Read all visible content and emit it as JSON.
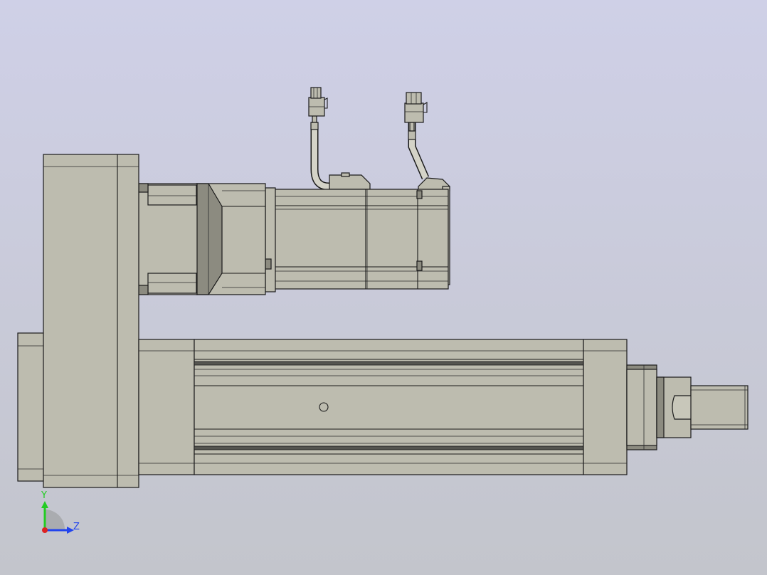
{
  "viewport": {
    "background_top": "#cfd0e7",
    "background_bottom": "#c3c5cc",
    "part_color": "#bdbcaf"
  },
  "triad": {
    "y_label": "Y",
    "z_label": "Z",
    "y_color": "#22cc22",
    "z_color": "#2244ee",
    "x_color": "#dd2222"
  }
}
